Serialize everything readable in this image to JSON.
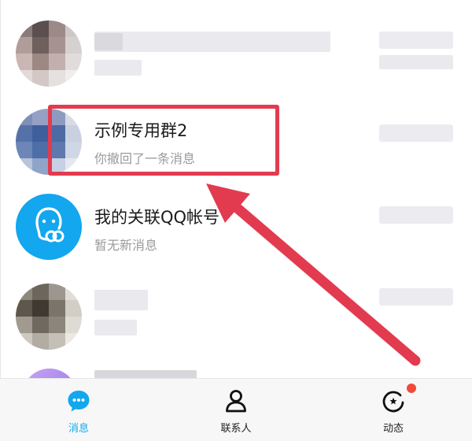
{
  "chats": [
    {
      "title": "",
      "subtitle": ""
    },
    {
      "title": "示例专用群2",
      "subtitle": "你撤回了一条消息"
    },
    {
      "title": "我的关联QQ帐号",
      "subtitle": "暂无新消息"
    },
    {
      "title": "",
      "subtitle": ""
    },
    {
      "title": "",
      "subtitle": ""
    }
  ],
  "tabs": [
    {
      "label": "消息",
      "icon": "chat-bubble-icon",
      "active": true
    },
    {
      "label": "联系人",
      "icon": "person-icon",
      "active": false
    },
    {
      "label": "动态",
      "icon": "spinning-star-icon",
      "active": false
    }
  ],
  "colors": {
    "accent": "#12a7ee",
    "highlight": "#e23b4f",
    "badge": "#f04a3a"
  }
}
